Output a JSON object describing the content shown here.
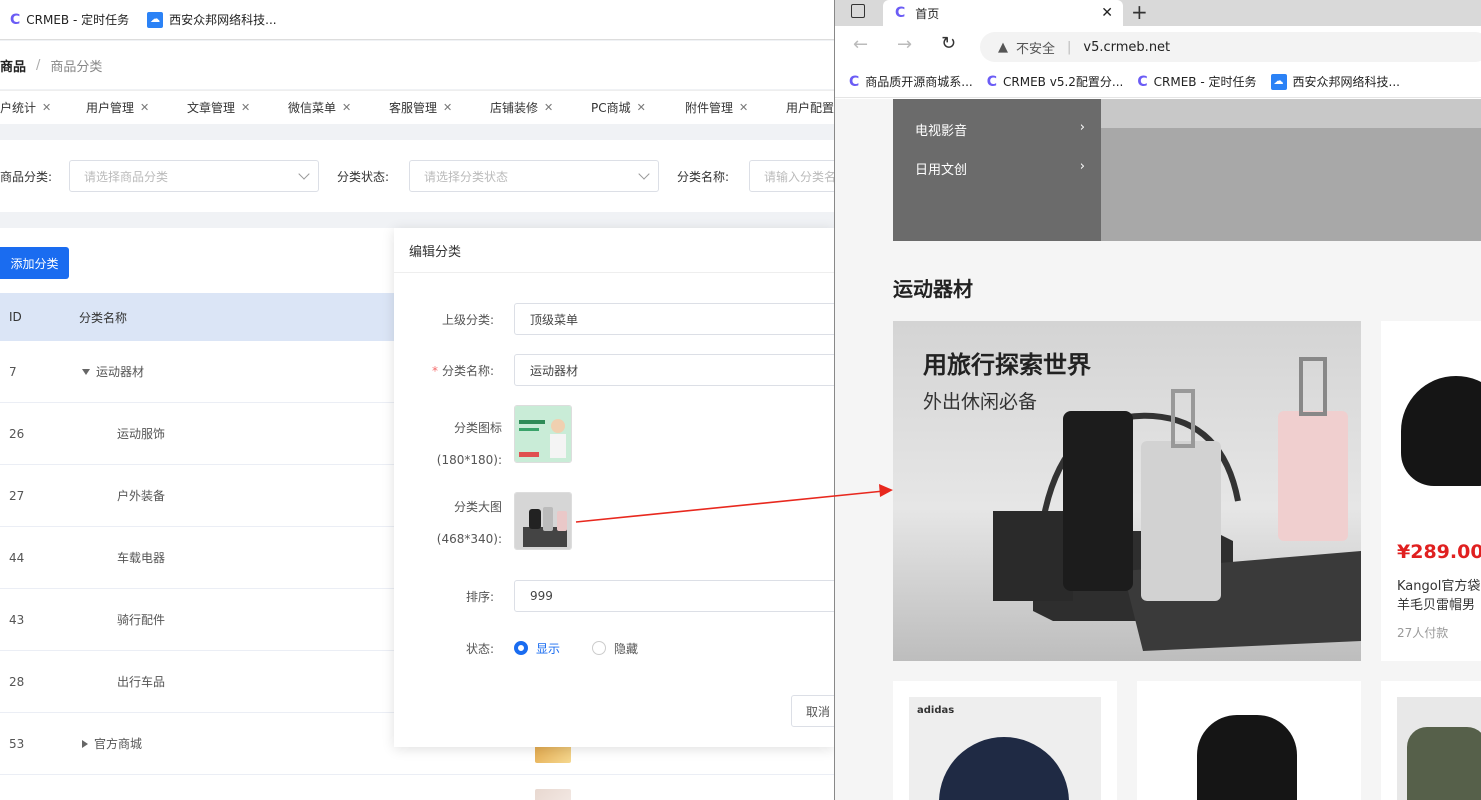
{
  "left_window": {
    "bookmarks": [
      {
        "label": "CRMEB - 定时任务",
        "icon": "crmeb-logo-icon"
      },
      {
        "label": "西安众邦网络科技...",
        "icon": "cloud-logo-icon"
      }
    ],
    "breadcrumb": {
      "root": "商品",
      "separator": "/",
      "current": "商品分类"
    },
    "tabs": [
      "户统计",
      "用户管理",
      "文章管理",
      "微信菜单",
      "客服管理",
      "店铺装修",
      "PC商城",
      "附件管理",
      "用户配置"
    ],
    "filters": {
      "category_label": "商品分类:",
      "category_placeholder": "请选择商品分类",
      "status_label": "分类状态:",
      "status_placeholder": "请选择分类状态",
      "name_label": "分类名称:",
      "name_placeholder": "请输入分类名"
    },
    "add_button": "添加分类",
    "table": {
      "headers": {
        "id": "ID",
        "name": "分类名称"
      },
      "rows": [
        {
          "id": "7",
          "name": "运动器材",
          "level": 0,
          "expanded": true
        },
        {
          "id": "26",
          "name": "运动服饰",
          "level": 1
        },
        {
          "id": "27",
          "name": "户外装备",
          "level": 1
        },
        {
          "id": "44",
          "name": "车载电器",
          "level": 1
        },
        {
          "id": "43",
          "name": "骑行配件",
          "level": 1
        },
        {
          "id": "28",
          "name": "出行车品",
          "level": 1
        },
        {
          "id": "53",
          "name": "官方商城",
          "level": 0,
          "expanded": false
        }
      ]
    },
    "modal": {
      "title": "编辑分类",
      "parent_label": "上级分类:",
      "parent_value": "顶级菜单",
      "name_label": "分类名称:",
      "name_value": "运动器材",
      "icon_label": "分类图标",
      "icon_size": "(180*180):",
      "big_label": "分类大图",
      "big_size": "(468*340):",
      "sort_label": "排序:",
      "sort_value": "999",
      "status_label": "状态:",
      "status_show": "显示",
      "status_hide": "隐藏",
      "selected_status": "显示",
      "cancel": "取消"
    }
  },
  "browser": {
    "tab_title": "首页",
    "security": "不安全",
    "url": "v5.crmeb.net",
    "bookmarks": [
      "商品质开源商城系...",
      "CRMEB v5.2配置分...",
      "CRMEB - 定时任务",
      "西安众邦网络科技..."
    ],
    "category_menu": [
      "电视影音",
      "日用文创"
    ],
    "section_title": "运动器材",
    "promo": {
      "headline": "用旅行探索世界",
      "subline": "外出休闲必备"
    },
    "product": {
      "price": "¥289.00",
      "name_line1": "Kangol官方袋",
      "name_line2": "羊毛贝雷帽男",
      "sold": "27人付款"
    },
    "brand_text": "adidas",
    "accent_color": "#1a6cf0",
    "price_color": "#e02020"
  }
}
